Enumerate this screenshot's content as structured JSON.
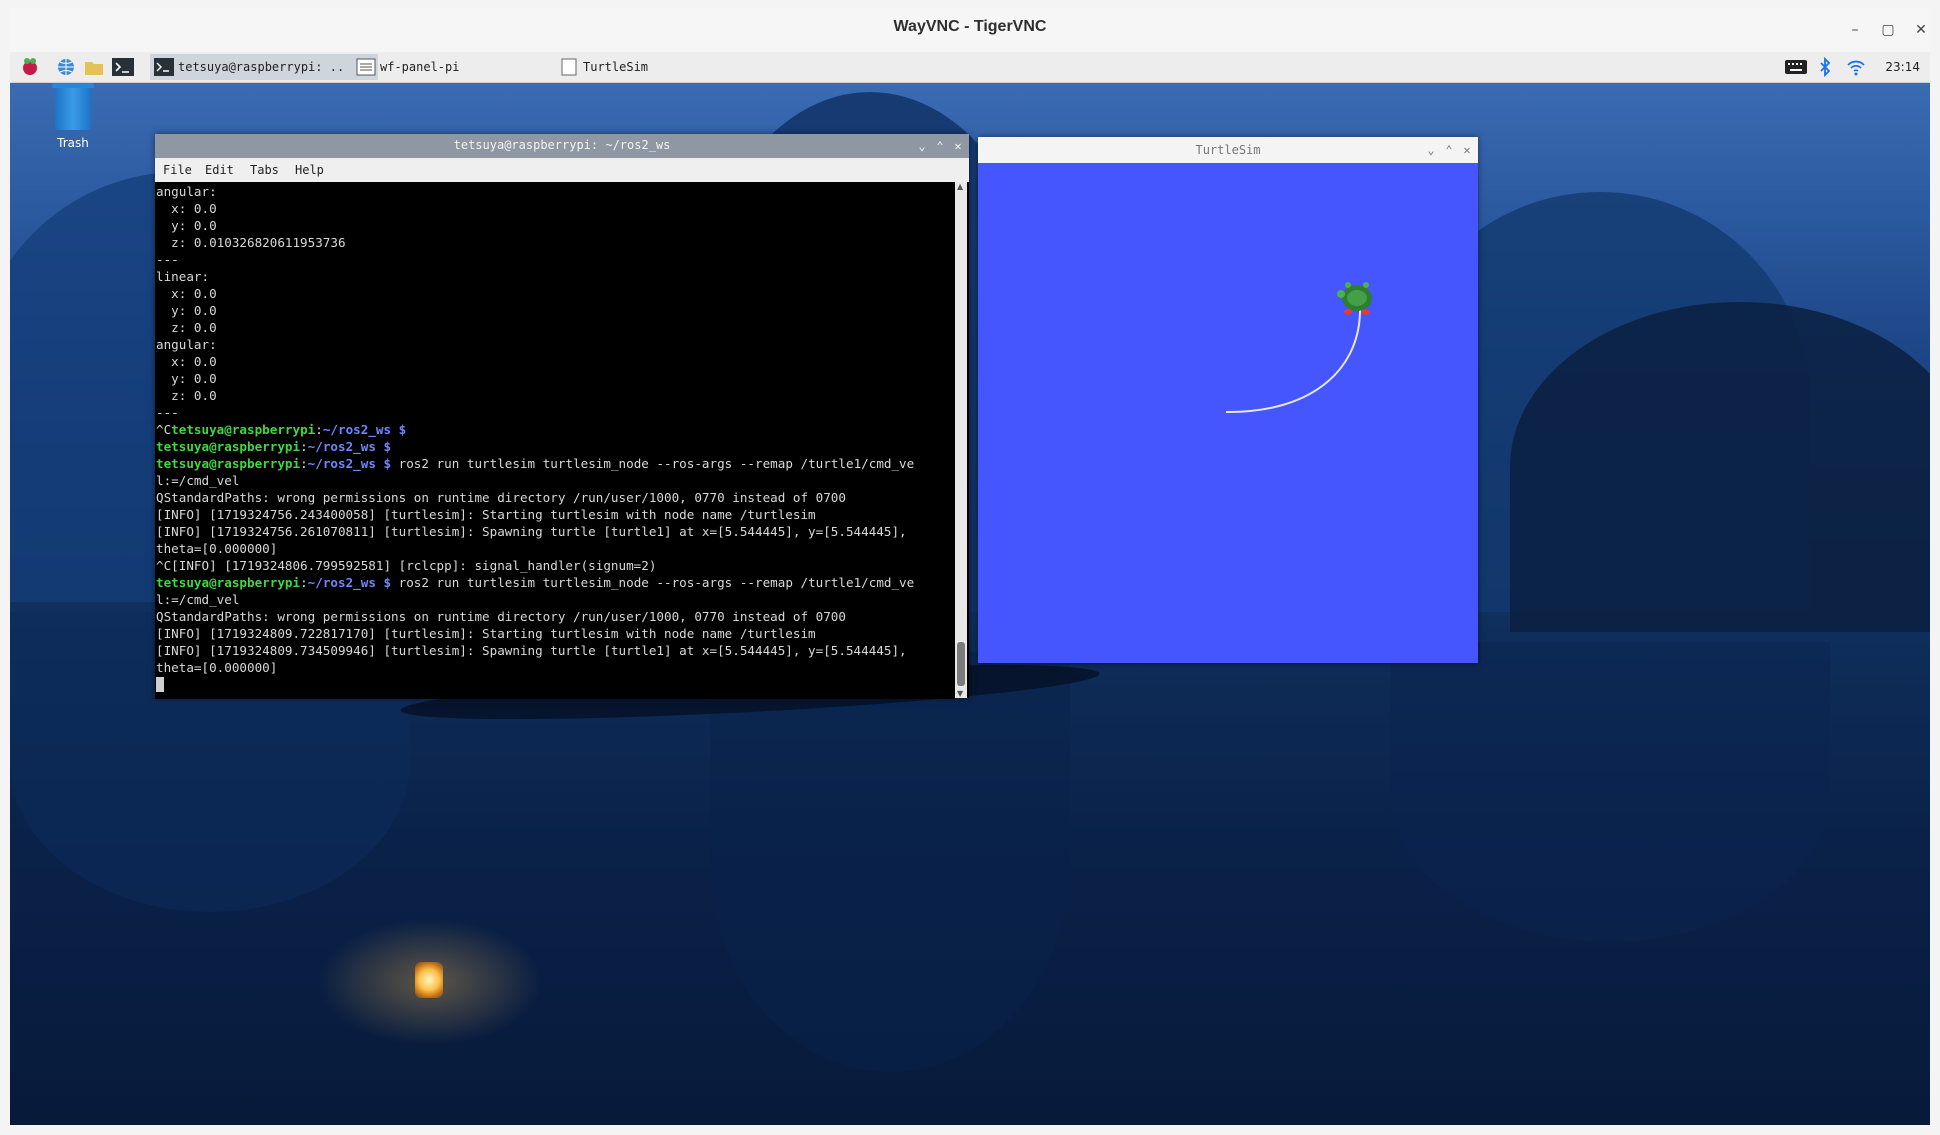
{
  "vnc": {
    "title": "WayVNC - TigerVNC"
  },
  "taskbar": {
    "tasks": [
      {
        "label": "tetsuya@raspberrypi: .."
      },
      {
        "label": "wf-panel-pi"
      },
      {
        "label": "TurtleSim"
      }
    ],
    "clock": "23:14",
    "colors": {
      "bluetooth": "#1a73e8",
      "wifi": "#1a73e8"
    }
  },
  "desktop": {
    "trash_label": "Trash"
  },
  "terminal": {
    "title": "tetsuya@raspberrypi: ~/ros2_ws",
    "menu": [
      "File",
      "Edit",
      "Tabs",
      "Help"
    ],
    "user": "tetsuya@raspberrypi",
    "path": "~/ros2_ws $",
    "lines": [
      "angular:",
      "  x: 0.0",
      "  y: 0.0",
      "  z: 0.010326820611953736",
      "---",
      "linear:",
      "  x: 0.0",
      "  y: 0.0",
      "  z: 0.0",
      "angular:",
      "  x: 0.0",
      "  y: 0.0",
      "  z: 0.0",
      "---"
    ],
    "prompt_lines": [
      {
        "prefix": "^C",
        "cmd": ""
      },
      {
        "prefix": "",
        "cmd": ""
      },
      {
        "prefix": "",
        "cmd": " ros2 run turtlesim turtlesim_node --ros-args --remap /turtle1/cmd_ve"
      }
    ],
    "output1": [
      "l:=/cmd_vel",
      "QStandardPaths: wrong permissions on runtime directory /run/user/1000, 0770 instead of 0700",
      "[INFO] [1719324756.243400058] [turtlesim]: Starting turtlesim with node name /turtlesim",
      "[INFO] [1719324756.261070811] [turtlesim]: Spawning turtle [turtle1] at x=[5.544445], y=[5.544445],",
      "theta=[0.000000]",
      "^C[INFO] [1719324806.799592581] [rclcpp]: signal_handler(signum=2)"
    ],
    "last_cmd": " ros2 run turtlesim turtlesim_node --ros-args --remap /turtle1/cmd_ve",
    "output2": [
      "l:=/cmd_vel",
      "QStandardPaths: wrong permissions on runtime directory /run/user/1000, 0770 instead of 0700",
      "[INFO] [1719324809.722817170] [turtlesim]: Starting turtlesim with node name /turtlesim",
      "[INFO] [1719324809.734509946] [turtlesim]: Spawning turtle [turtle1] at x=[5.544445], y=[5.544445],",
      "theta=[0.000000]"
    ]
  },
  "turtlesim": {
    "title": "TurtleSim",
    "background_color": "#4556ff",
    "trail_color": "#e8e8f0"
  }
}
